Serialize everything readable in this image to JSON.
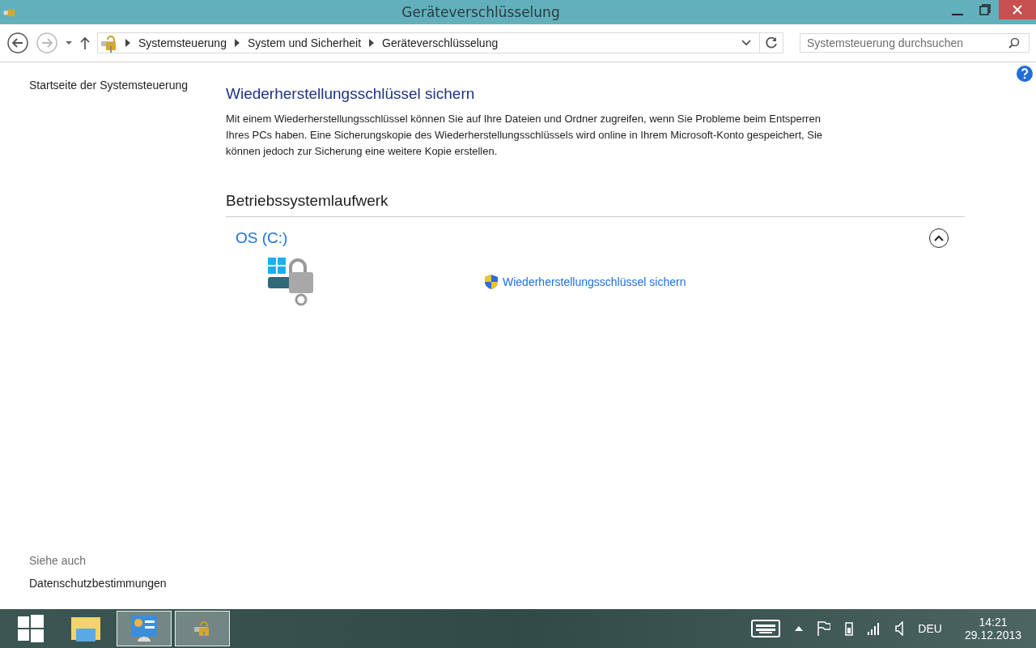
{
  "window": {
    "title": "Geräteverschlüsselung"
  },
  "address_bar": {
    "crumbs": [
      "Systemsteuerung",
      "System und Sicherheit",
      "Geräteverschlüsselung"
    ]
  },
  "search": {
    "placeholder": "Systemsteuerung durchsuchen"
  },
  "sidebar": {
    "home_link": "Startseite der Systemsteuerung",
    "see_also_heading": "Siehe auch",
    "see_also_links": [
      "Datenschutzbestimmungen"
    ]
  },
  "main": {
    "heading": "Wiederherstellungsschlüssel sichern",
    "description": "Mit einem Wiederherstellungsschlüssel können Sie auf Ihre Dateien und Ordner zugreifen, wenn Sie Probleme beim Entsperren Ihres PCs haben. Eine Sicherungskopie des Wiederherstellungsschlüssels wird online in Ihrem Microsoft-Konto gespeichert, Sie können jedoch zur Sicherung eine weitere Kopie erstellen.",
    "section_heading": "Betriebssystemlaufwerk",
    "drive": {
      "name": "OS (C:)",
      "expanded": true,
      "action": "Wiederherstellungsschlüssel sichern"
    }
  },
  "taskbar": {
    "apps": [
      {
        "kind": "explorer",
        "selected": false
      },
      {
        "kind": "control-panel",
        "selected": true
      },
      {
        "kind": "encryption",
        "selected": true
      }
    ],
    "language": "DEU",
    "time": "14:21",
    "date": "29.12.2013"
  }
}
